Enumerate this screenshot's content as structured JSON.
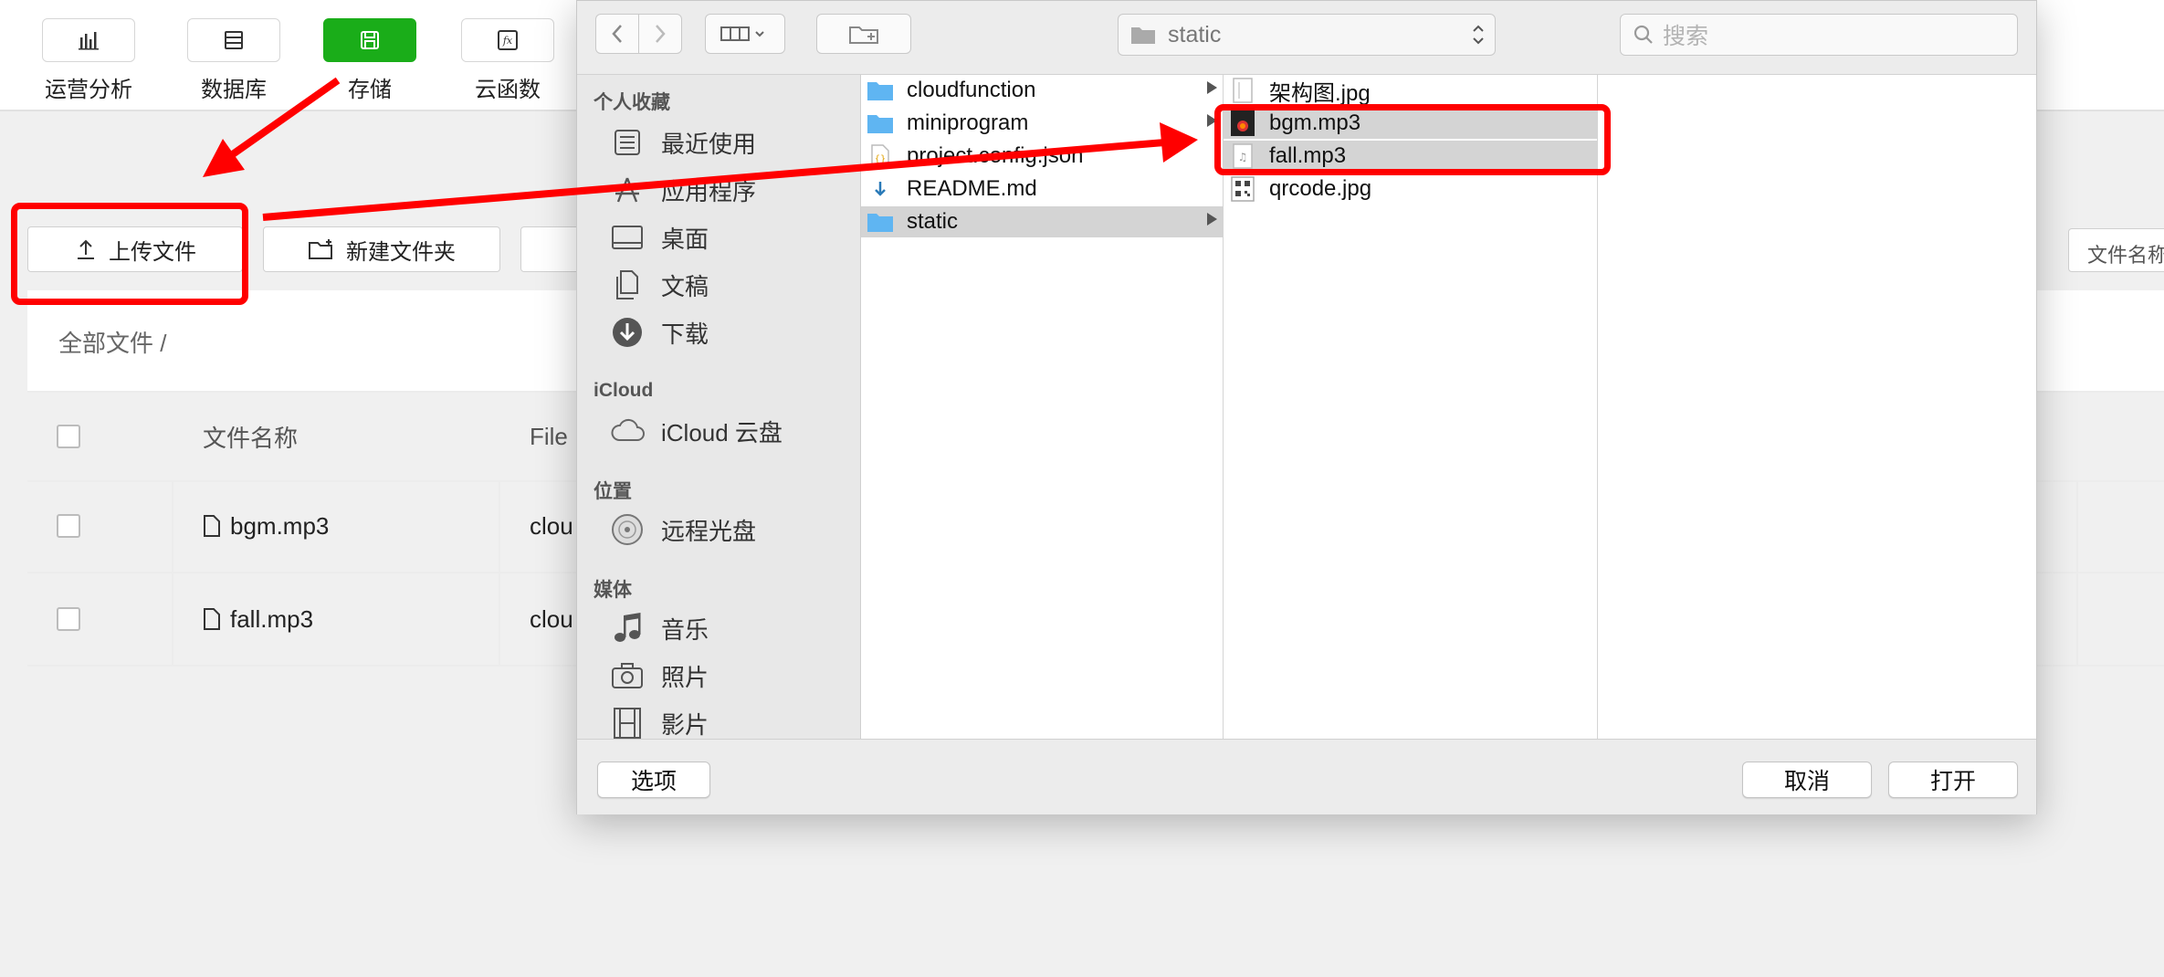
{
  "topnav": {
    "items": [
      {
        "label": "运营分析",
        "icon": "bar-chart-icon"
      },
      {
        "label": "数据库",
        "icon": "database-icon"
      },
      {
        "label": "存储",
        "icon": "storage-icon",
        "active": true
      },
      {
        "label": "云函数",
        "icon": "function-icon"
      }
    ]
  },
  "toolbar": {
    "upload_label": "上传文件",
    "new_folder_label": "新建文件夹"
  },
  "search": {
    "placeholder": "文件名称"
  },
  "breadcrumb": "全部文件  /",
  "table": {
    "headers": [
      "文件名称",
      "File"
    ],
    "rows": [
      {
        "name": "bgm.mp3",
        "file_id": "clou"
      },
      {
        "name": "fall.mp3",
        "file_id": "clou"
      }
    ]
  },
  "dialog": {
    "path": "static",
    "search_placeholder": "搜索",
    "sidebar": {
      "favorites_title": "个人收藏",
      "favorites": [
        {
          "label": "最近使用",
          "icon": "recents-icon"
        },
        {
          "label": "应用程序",
          "icon": "applications-icon"
        },
        {
          "label": "桌面",
          "icon": "desktop-icon"
        },
        {
          "label": "文稿",
          "icon": "documents-icon"
        },
        {
          "label": "下载",
          "icon": "downloads-icon"
        }
      ],
      "icloud_title": "iCloud",
      "icloud": [
        {
          "label": "iCloud 云盘",
          "icon": "cloud-icon"
        }
      ],
      "locations_title": "位置",
      "locations": [
        {
          "label": "远程光盘",
          "icon": "disc-icon"
        }
      ],
      "media_title": "媒体",
      "media": [
        {
          "label": "音乐",
          "icon": "music-icon"
        },
        {
          "label": "照片",
          "icon": "camera-icon"
        },
        {
          "label": "影片",
          "icon": "film-icon"
        }
      ]
    },
    "column1": [
      {
        "name": "cloudfunction",
        "type": "folder"
      },
      {
        "name": "miniprogram",
        "type": "folder"
      },
      {
        "name": "project.config.json",
        "type": "json"
      },
      {
        "name": "README.md",
        "type": "md"
      },
      {
        "name": "static",
        "type": "folder",
        "selected": true
      }
    ],
    "column2": [
      {
        "name": "架构图.jpg",
        "type": "image"
      },
      {
        "name": "bgm.mp3",
        "type": "audio-art",
        "selected": true
      },
      {
        "name": "fall.mp3",
        "type": "audio",
        "selected": true
      },
      {
        "name": "qrcode.jpg",
        "type": "qrcode"
      }
    ],
    "options_label": "选项",
    "cancel_label": "取消",
    "open_label": "打开"
  },
  "colors": {
    "accent": "#1aad19",
    "annotation": "#ff0000",
    "finder_folder": "#5fb5f2"
  }
}
